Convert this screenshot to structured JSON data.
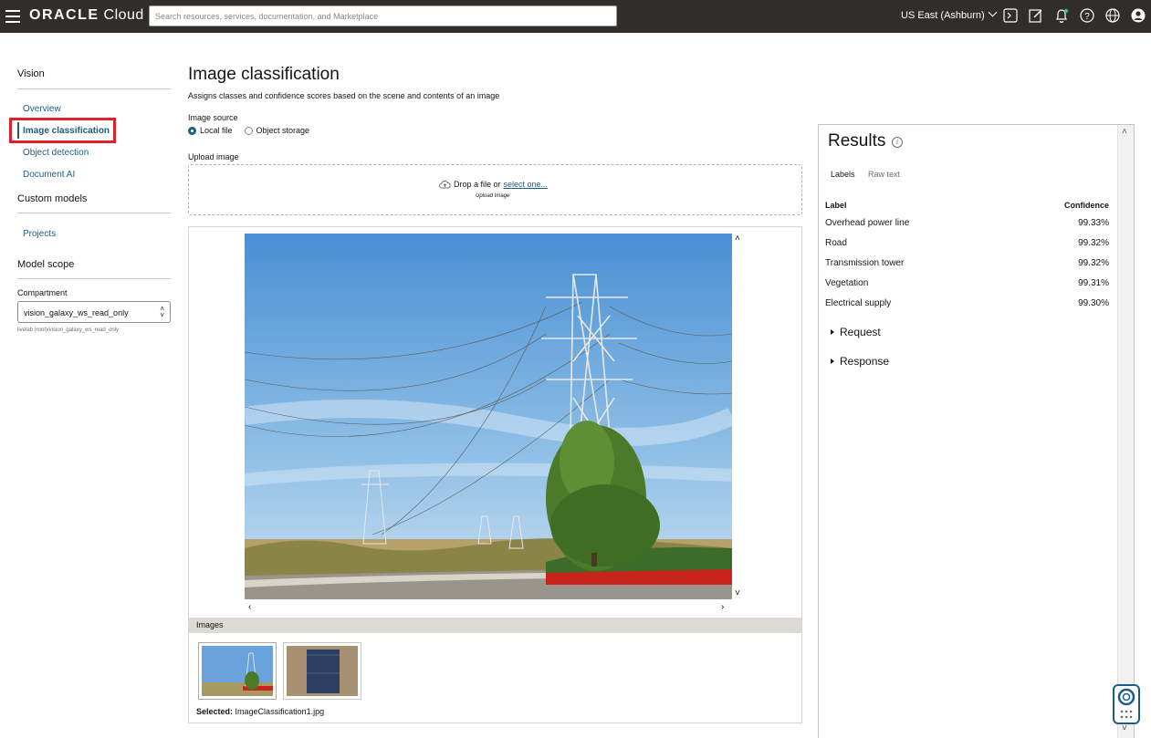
{
  "topbar": {
    "brand_bold": "ORACLE",
    "brand_light": "Cloud",
    "search_placeholder": "Search resources, services, documentation, and Marketplace",
    "region": "US East (Ashburn)",
    "icons": [
      "cloud-shell-icon",
      "code-editor-icon",
      "notifications-icon",
      "help-icon",
      "language-icon",
      "profile-icon"
    ]
  },
  "sidebar": {
    "section1": "Vision",
    "links": [
      "Overview",
      "Image classification",
      "Object detection",
      "Document AI"
    ],
    "section2": "Custom models",
    "custom_links": [
      "Projects"
    ],
    "section3": "Model scope",
    "compartment_label": "Compartment",
    "compartment_value": "vision_galaxy_ws_read_only",
    "compartment_path": "livelab (root)/vision_galaxy_ws_read_only"
  },
  "main": {
    "title": "Image classification",
    "description": "Assigns classes and confidence scores based on the scene and contents of an image",
    "image_source_label": "Image source",
    "source_options": [
      "Local file",
      "Object storage"
    ],
    "upload_label": "Upload image",
    "drop_text": "Drop a file or",
    "drop_link": "select one...",
    "drop_sub": "Upload Image",
    "images_header": "Images",
    "selected_label": "Selected:",
    "selected_file": "ImageClassification1.jpg"
  },
  "results": {
    "title": "Results",
    "tabs": [
      "Labels",
      "Raw text"
    ],
    "col_label": "Label",
    "col_confidence": "Confidence",
    "rows": [
      {
        "label": "Overhead power line",
        "confidence": "99.33%"
      },
      {
        "label": "Road",
        "confidence": "99.32%"
      },
      {
        "label": "Transmission tower",
        "confidence": "99.32%"
      },
      {
        "label": "Vegetation",
        "confidence": "99.31%"
      },
      {
        "label": "Electrical supply",
        "confidence": "99.30%"
      }
    ],
    "expanders": [
      "Request",
      "Response"
    ]
  },
  "colors": {
    "topbar": "#312d2a",
    "link": "#1c5e86",
    "highlight": "#e0202a"
  }
}
